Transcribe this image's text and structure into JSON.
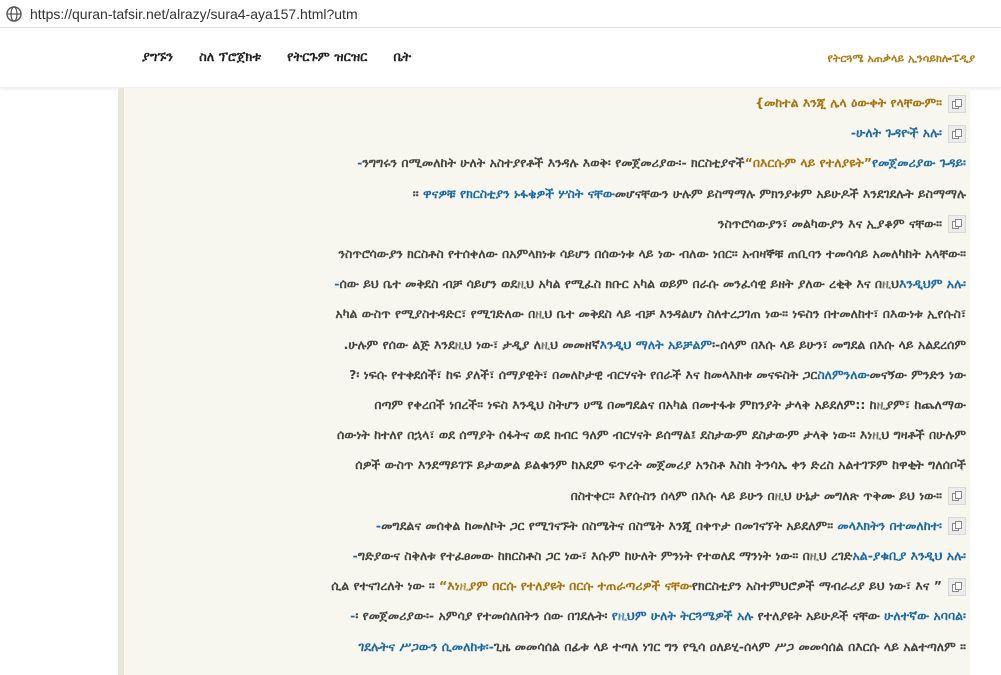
{
  "browser": {
    "url": "https://quran-tafsir.net/alrazy/sura4-aya157.html?utm",
    "site_icon": "globe-icon"
  },
  "nav": {
    "links": [
      "ያግኙን",
      "ስለ ፕሮጀክቱ",
      "የትርጉም ዝርዝር",
      "ቤት"
    ],
    "brand": "የትርጓሜ አጠቃላይ ኢንሳይክሎፔዲያ"
  },
  "article": {
    "p1_l1": "መከተል እንጂ ሌላ ዕውቀት የላቸውም።}",
    "p2_l1": "ሁለት ጉዳዮች አሉ፡-",
    "p3_l1a": "ንግግሩን በሚመለከት ሁለት አስተያየቶች እንዳሉ እወቅ፡ የመጀመሪያው፡- ክርስቲያኖች",
    "p3_l1b": "“በእርሱም ላይ የተለያዩት”",
    "p3_l1c": "የመጀመሪያው ጉዳይ፡-",
    "p3_l2a": "፡፡ ",
    "p3_l2b": "ዋናዎቹ የክርስቲያን ኑፋቄዎች ሦስት ናቸው",
    "p3_l2c": "መሆናቸውን ሁሉም ይስማማሉ ምክንያቱም አይሁዶች እንደገደሉት ይስማማሉ",
    "p3_l3": "ንስጥሮሳውያን፣ መልካውያን እና ኢያቆም ናቸው።",
    "p4_l1": "ንስጥሮሳውያን ክርስቶስ የተሰቀለው በአምላክነቱ ሳይሆን በሰውነቱ ላይ ነው ብለው ነበር። አብዛኞቹ ጠቢባን ተመሳሳይ አመለካከት አላቸው።",
    "p4_l2a": "ሰው ይህ ቤተ መቅደስ ብቻ ሳይሆን ወደዚህ አካል የሚፈስ ክቡር አካል ወይም በራሱ መንፈሳዊ ይዘት ያለው ረቂቅ እና በዚህ",
    "p4_l2b": "እንዲህም አሉ፡-",
    "p4_l3": "አካል ውስጥ የሚያስተዳድር፣ የሚገድለው በዚህ ቤተ መቅደስ ላይ ብቻ እንዳልሆነ ስለተረጋገጠ ነው። ነፍስን በተመለከተ፣ በእውነቱ ኢየሱስ፣",
    "p4_l4a": "ሁሉም የሰው ልጅ እንደዚህ ነው፣ ታዲያ ለዚህ መመዘኛ",
    "p4_l4b": "እንዲህ ማለት አይቻልም",
    "p4_l4c": "፡-ሰላም በእሱ ላይ ይሁን፣ መግደል በእሱ ላይ አልደረሰም.",
    "p4_l5a": "፡ ነፍሱ የተቀደሰች፣ ከፍ ያለች፣ ሰማያዊት፣ በመለኮታዊ ብርሃናት የበራች እና ከመላእክቱ መናፍስት ጋር",
    "p4_l5b": "ስለምንለው",
    "p4_l5c": "መናኝው ምንድን ነው?",
    "p4_l6": "በጣም የቀረበች ነበረች። ነፍስ እንዲህ ስትሆን ሀሜ በመግደልና በአካል በመተፋቱ ምክንያት ታላቅ አይደለም:: ከዚያም፣ ከጨለማው",
    "p4_l7": "ሰውነት ከተለየ በኋላ፣ ወደ ሰማያት ሰፋትና ወደ ክብር ዓለም ብርሃናት ይሰማል፤ ደስታውም ደስታውም ታላቅ ነው። እነዚህ ግዛቶች በሁሉም",
    "p4_l8": "ሰዎች ውስጥ እንደማይገኙ ይታወቃል ይልቁንም ከአደም ፍጥረት መጀመሪያ አንስቶ እስከ ትንሳኤ ቀን ድረስ አልተገኙም ከዋቂት ግለሰቦች",
    "p4_l9": "በስተቀር። እየሱስን ሰላም በእሱ ላይ ይሁን በዚህ ሁኔታ መግለጽ ጥቅሙ ይህ ነው።",
    "p5_l1a": "መግደልና መሰቀል ከመለኮት ጋር የሚገናኙት በስሜትና በስሜት እንጂ በቀጥታ በመገናኘት አይደለም። ",
    "p5_l1b": "መላእክትን በተመለከተ፡-",
    "p6_l1a": "ግድያውና ስቅለቱ የተፈፀመው ከክርስቶስ ጋር ነው፣ እሱም ከሁለት ምንነት የተወለደ ማንነት ነው። በዚህ ረገድ",
    "p6_l1b": "አል-ያቁቢያ እንዲህ አሉ፡-",
    "p6_l2a": "” ሲል የተናገረለት ነው ። ",
    "p6_l2b": "“እነዚያም በርሱ የተለያዩት በርሱ ተጠራጣሪዎች ናቸው",
    "p6_l2c": "የክርስቲያን አስተምህሮዎች ማብራሪያ ይህ ነው፣ እና",
    "p7_l1a": "፡ የመጀመሪያው፡- አምሳያ የተመሰለበትን ሰው በገደሉት፡ ",
    "p7_l1b": "የዚህም ሁለት ትርጓሜዎች አሉ",
    "p7_l1c": " የተለያዩት አይሁዶች ናቸው ",
    "p7_l1d": "ሁለተኛው አባባል፡-",
    "p7_l2a": "ገደሉትና ሥጋውን ሲመለከቱ፡-",
    "p7_l2b": "ጊዜ መመሳሰል በፊቱ ላይ ተጣለ ነገር ግን የዒሳ ዐለይሂ-ሰላም ሥጋ መመሳሰል በእርሱ ላይ አልተጣለም ።"
  },
  "colors": {
    "link_blue": "#1b6aa5",
    "quote_gold": "#a8720c",
    "brand_gold": "#b07a10",
    "panel_bg": "#f7f6ef"
  }
}
